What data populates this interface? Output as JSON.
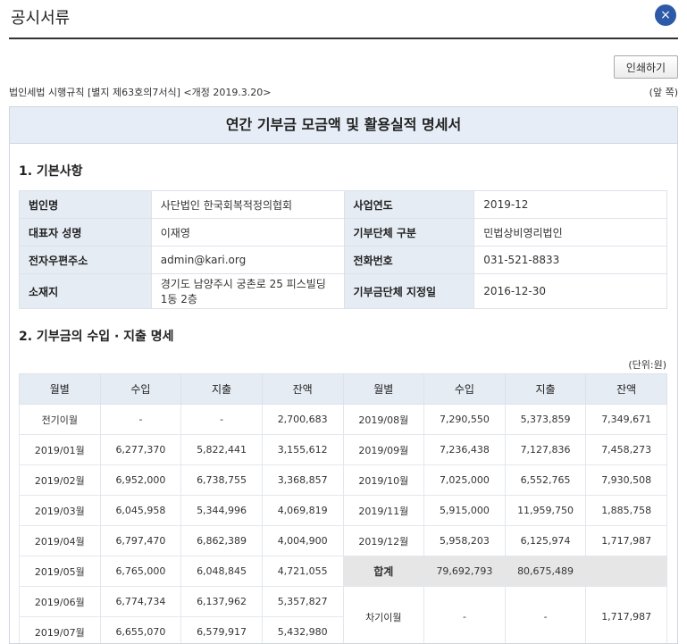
{
  "header": {
    "title": "공시서류",
    "close_icon": "×"
  },
  "toolbar": {
    "print_label": "인쇄하기"
  },
  "law": {
    "text": "법인세법 시행규칙 [별지 제63호의7서식] <개정 2019.3.20>",
    "front_label": "(앞 쪽)"
  },
  "doc": {
    "title": "연간 기부금 모금액 및 활용실적 명세서"
  },
  "section1": {
    "title": "1. 기본사항",
    "rows": [
      {
        "l1": "법인명",
        "v1": "사단법인 한국회복적정의협회",
        "l2": "사업연도",
        "v2": "2019-12"
      },
      {
        "l1": "대표자 성명",
        "v1": "이재영",
        "l2": "기부단체 구분",
        "v2": "민법상비영리법인"
      },
      {
        "l1": "전자우편주소",
        "v1": "admin@kari.org",
        "l2": "전화번호",
        "v2": "031-521-8833"
      },
      {
        "l1": "소재지",
        "v1": "경기도 남양주시 궁촌로 25 피스빌딩 1동 2층",
        "l2": "기부금단체 지정일",
        "v2": "2016-12-30"
      }
    ]
  },
  "section2": {
    "title": "2. 기부금의 수입 · 지출 명세",
    "unit": "(단위:원)",
    "headers": [
      "월별",
      "수입",
      "지출",
      "잔액",
      "월별",
      "수입",
      "지출",
      "잔액"
    ],
    "left_rows": [
      [
        "전기이월",
        "-",
        "-",
        "2,700,683"
      ],
      [
        "2019/01월",
        "6,277,370",
        "5,822,441",
        "3,155,612"
      ],
      [
        "2019/02월",
        "6,952,000",
        "6,738,755",
        "3,368,857"
      ],
      [
        "2019/03월",
        "6,045,958",
        "5,344,996",
        "4,069,819"
      ],
      [
        "2019/04월",
        "6,797,470",
        "6,862,389",
        "4,004,900"
      ],
      [
        "2019/05월",
        "6,765,000",
        "6,048,845",
        "4,721,055"
      ],
      [
        "2019/06월",
        "6,774,734",
        "6,137,962",
        "5,357,827"
      ],
      [
        "2019/07월",
        "6,655,070",
        "6,579,917",
        "5,432,980"
      ]
    ],
    "right_rows": [
      [
        "2019/08월",
        "7,290,550",
        "5,373,859",
        "7,349,671"
      ],
      [
        "2019/09월",
        "7,236,438",
        "7,127,836",
        "7,458,273"
      ],
      [
        "2019/10월",
        "7,025,000",
        "6,552,765",
        "7,930,508"
      ],
      [
        "2019/11월",
        "5,915,000",
        "11,959,750",
        "1,885,758"
      ],
      [
        "2019/12월",
        "5,958,203",
        "6,125,974",
        "1,717,987"
      ]
    ],
    "total": {
      "label": "합계",
      "income": "79,692,793",
      "expense": "80,675,489",
      "balance": ""
    },
    "carry": {
      "label": "차기이월",
      "income": "-",
      "expense": "-",
      "balance": "1,717,987"
    }
  }
}
